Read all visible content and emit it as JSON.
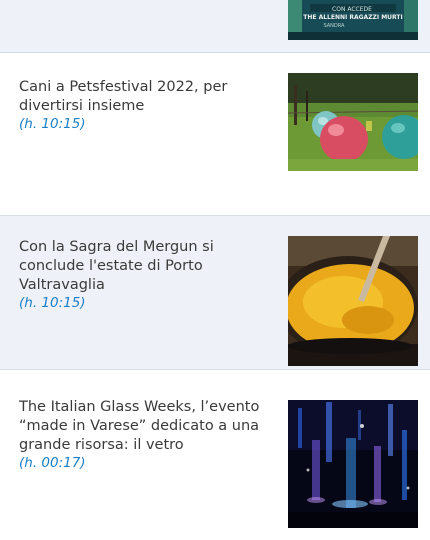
{
  "articles": [
    {
      "title": "",
      "time": "",
      "image_icon": "poster-image-icon"
    },
    {
      "title": "Cani a Petsfestival 2022, per divertirsi insieme",
      "time": "(h. 10:15)",
      "image_icon": "balls-on-grass-image-icon"
    },
    {
      "title": "Con la Sagra del Mergun si conclude l'estate di Porto Valtravaglia",
      "time": "(h. 10:15)",
      "image_icon": "polenta-pot-image-icon"
    },
    {
      "title": "The Italian Glass Weeks, l’evento “made in Varese” dedicato a una grande risorsa: il vetro",
      "time": "(h. 00:17)",
      "image_icon": "glass-lights-image-icon"
    }
  ],
  "poster_lines": [
    "CON ACCEDE",
    "THE ALLENNI RAGAZZI MURTI",
    "SANDRA"
  ],
  "colors": {
    "shaded_bg": "#eef2f8",
    "time_text": "#1a7fc7",
    "title_text": "#3a3a3a"
  }
}
